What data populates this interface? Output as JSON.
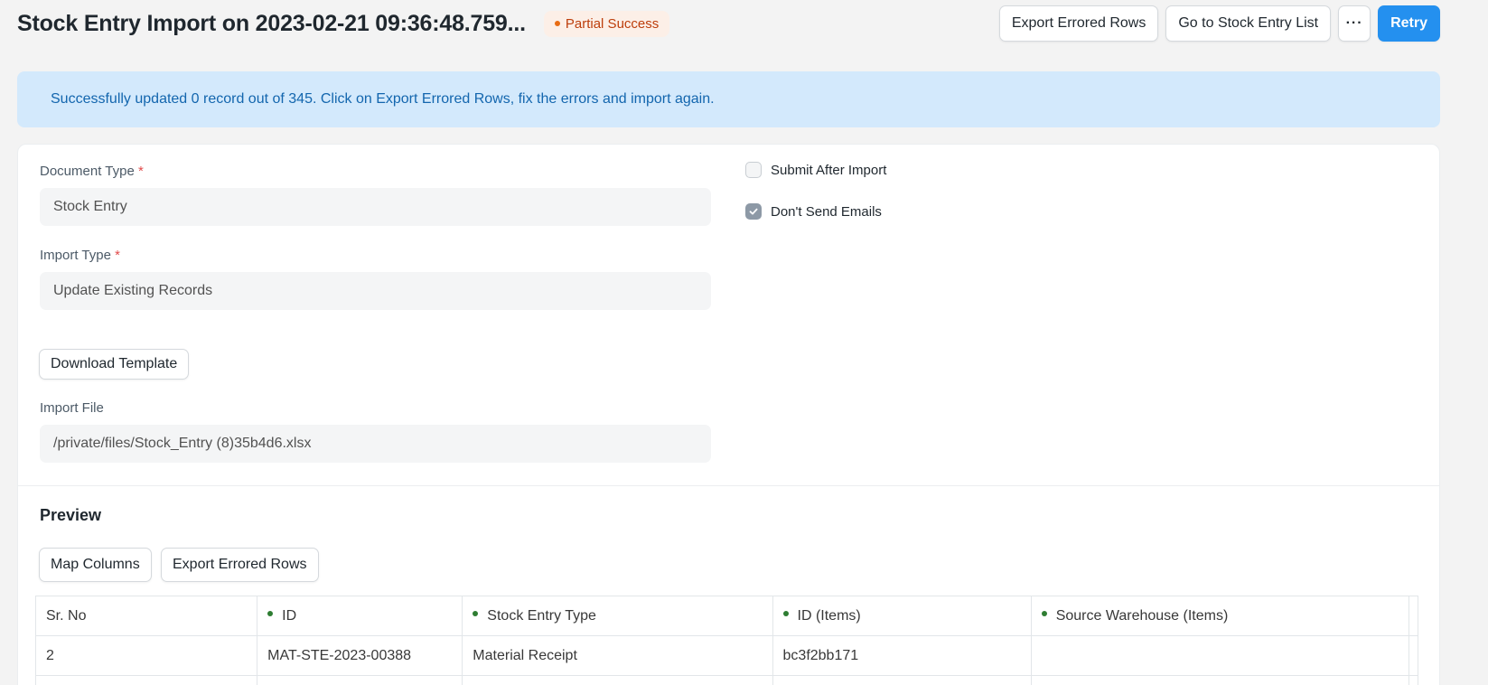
{
  "header": {
    "title": "Stock Entry Import on 2023-02-21 09:36:48.759...",
    "status": "Partial Success",
    "status_color": "#e86c13",
    "buttons": {
      "export_errored": "Export Errored Rows",
      "go_to_list": "Go to Stock Entry List",
      "more": "···",
      "retry": "Retry"
    }
  },
  "alert": {
    "message": "Successfully updated 0 record out of 345. Click on Export Errored Rows, fix the errors and import again."
  },
  "form": {
    "document_type": {
      "label": "Document Type",
      "required": "*",
      "value": "Stock Entry"
    },
    "import_type": {
      "label": "Import Type",
      "required": "*",
      "value": "Update Existing Records"
    },
    "download_template": "Download Template",
    "import_file": {
      "label": "Import File",
      "value": "/private/files/Stock_Entry (8)35b4d6.xlsx"
    },
    "submit_after_import": {
      "label": "Submit After Import",
      "checked": false
    },
    "dont_send_emails": {
      "label": "Don't Send Emails",
      "checked": true
    }
  },
  "preview": {
    "title": "Preview",
    "buttons": {
      "map_columns": "Map Columns",
      "export_errored": "Export Errored Rows"
    },
    "columns": [
      "Sr. No",
      "ID",
      "Stock Entry Type",
      "ID (Items)",
      "Source Warehouse (Items)"
    ],
    "rows": [
      [
        "2",
        "MAT-STE-2023-00388",
        "Material Receipt",
        "bc3f2bb171",
        ""
      ]
    ]
  }
}
